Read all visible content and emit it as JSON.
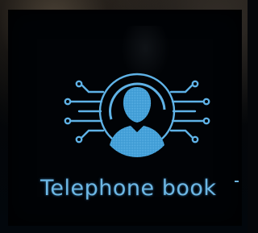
{
  "screen": {
    "title": "Telephone book",
    "icon": "contact-person-circuit-icon"
  },
  "colors": {
    "accent": "#6db7e4",
    "background": "#010306"
  }
}
